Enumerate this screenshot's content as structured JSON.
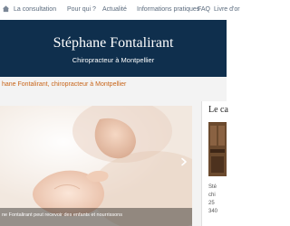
{
  "nav": {
    "items": [
      "La consultation",
      "Pour qui ?",
      "Actualité",
      "Informations pratiques",
      "FAQ",
      "Livre d'or"
    ]
  },
  "header": {
    "title": "Stéphane Fontalirant",
    "subtitle": "Chiropracteur à Montpellier"
  },
  "breadcrumb": "hane Fontalirant, chiropracteur à Montpellier",
  "slider": {
    "caption": "ne Fontalirant peut recevoir des enfants et nourrissons"
  },
  "sidebar": {
    "title": "Le ca",
    "lines": [
      "Sté",
      "chi",
      "25",
      "340"
    ]
  },
  "colors": {
    "banner": "#0f2f4d",
    "accent": "#c8651a",
    "nav_text": "#5a6a7d"
  }
}
